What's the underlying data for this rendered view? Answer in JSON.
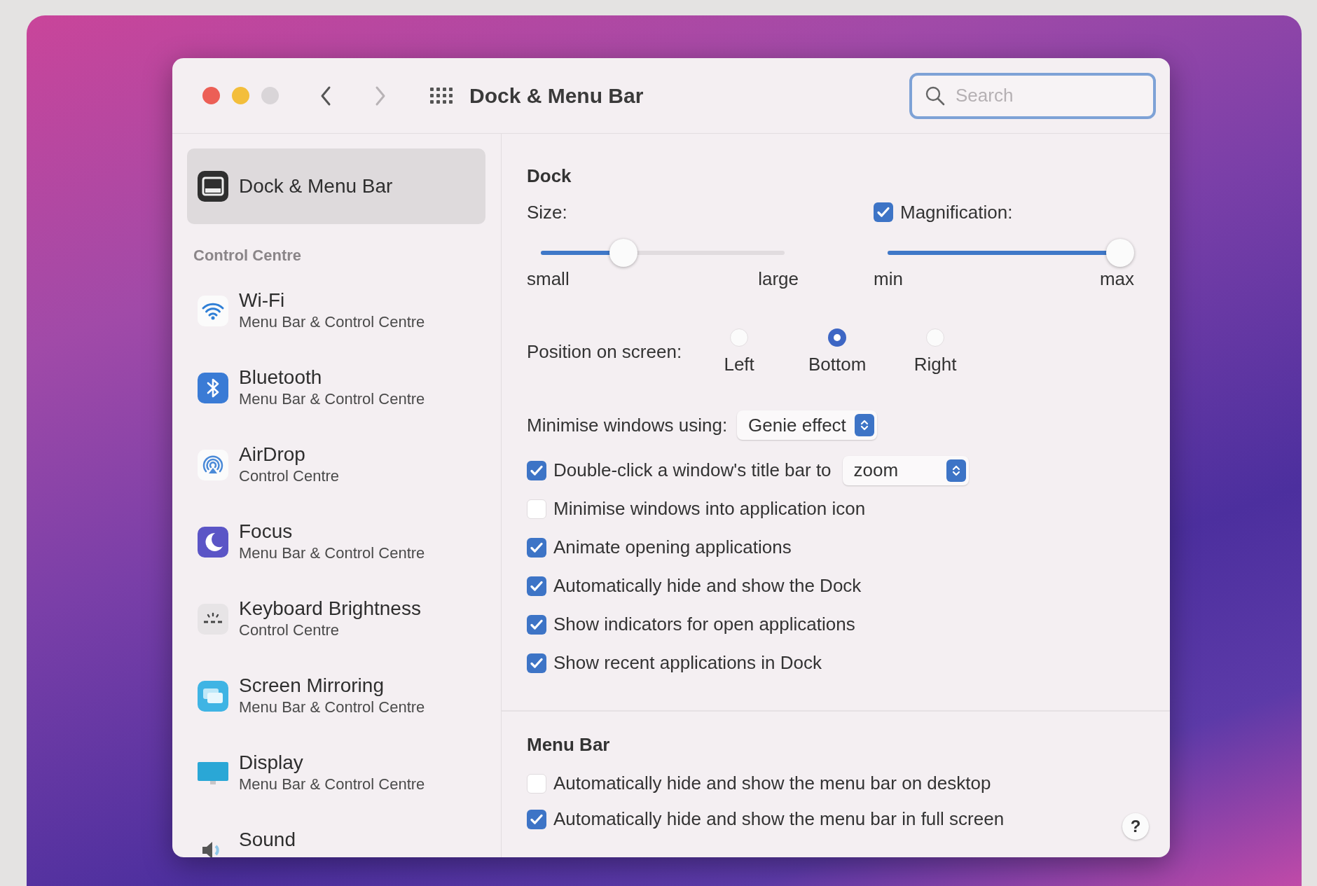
{
  "window": {
    "title": "Dock & Menu Bar"
  },
  "nav": {
    "back": {
      "disabled": false
    },
    "forward": {
      "disabled": true
    }
  },
  "search": {
    "placeholder": "Search",
    "focused": true
  },
  "sidebar": {
    "items": [
      {
        "kind": "dock",
        "label": "Dock & Menu Bar",
        "selected": true
      }
    ],
    "section": "Control Centre",
    "section_items": [
      {
        "kind": "wifi",
        "label": "Wi-Fi",
        "subtitle": "Menu Bar & Control Centre",
        "selected": false
      },
      {
        "kind": "bluetooth",
        "label": "Bluetooth",
        "subtitle": "Menu Bar & Control Centre",
        "selected": false
      },
      {
        "kind": "airdrop",
        "label": "AirDrop",
        "subtitle": "Control Centre",
        "selected": false
      },
      {
        "kind": "focus",
        "label": "Focus",
        "subtitle": "Menu Bar & Control Centre",
        "selected": false
      },
      {
        "kind": "keyboard",
        "label": "Keyboard Brightness",
        "subtitle": "Control Centre",
        "selected": false
      },
      {
        "kind": "mirroring",
        "label": "Screen Mirroring",
        "subtitle": "Menu Bar & Control Centre",
        "selected": false
      },
      {
        "kind": "display",
        "label": "Display",
        "subtitle": "Menu Bar & Control Centre",
        "selected": false
      },
      {
        "kind": "sound",
        "label": "Sound",
        "selected": false
      }
    ]
  },
  "dock": {
    "heading": "Dock",
    "size": {
      "label": "Size:",
      "level": 0.34,
      "min_label": "small",
      "max_label": "large"
    },
    "magnification": {
      "label": "Magnification:",
      "checked": true,
      "level": 1,
      "min_label": "min",
      "max_label": "max"
    },
    "position": {
      "label": "Position on screen:",
      "options": [
        {
          "label": "Left",
          "selected": false
        },
        {
          "label": "Bottom",
          "selected": true
        },
        {
          "label": "Right",
          "selected": false
        }
      ]
    },
    "minimise": {
      "label": "Minimise windows using:",
      "value": "Genie effect"
    },
    "options": [
      {
        "kind": "popup",
        "label": "Double-click a window's title bar to",
        "checked": true,
        "value": "zoom"
      },
      {
        "kind": "plain",
        "label": "Minimise windows into application icon",
        "checked": false
      },
      {
        "kind": "plain",
        "label": "Animate opening applications",
        "checked": true
      },
      {
        "kind": "plain",
        "label": "Automatically hide and show the Dock",
        "checked": true
      },
      {
        "kind": "plain",
        "label": "Show indicators for open applications",
        "checked": true
      },
      {
        "kind": "plain",
        "label": "Show recent applications in Dock",
        "checked": true
      }
    ]
  },
  "menu_bar": {
    "heading": "Menu Bar",
    "options": [
      {
        "kind": "plain",
        "label": "Automatically hide and show the menu bar on desktop",
        "checked": false
      },
      {
        "kind": "plain",
        "label": "Automatically hide and show the menu bar in full screen",
        "checked": true
      }
    ]
  },
  "help": {
    "label": "?"
  }
}
